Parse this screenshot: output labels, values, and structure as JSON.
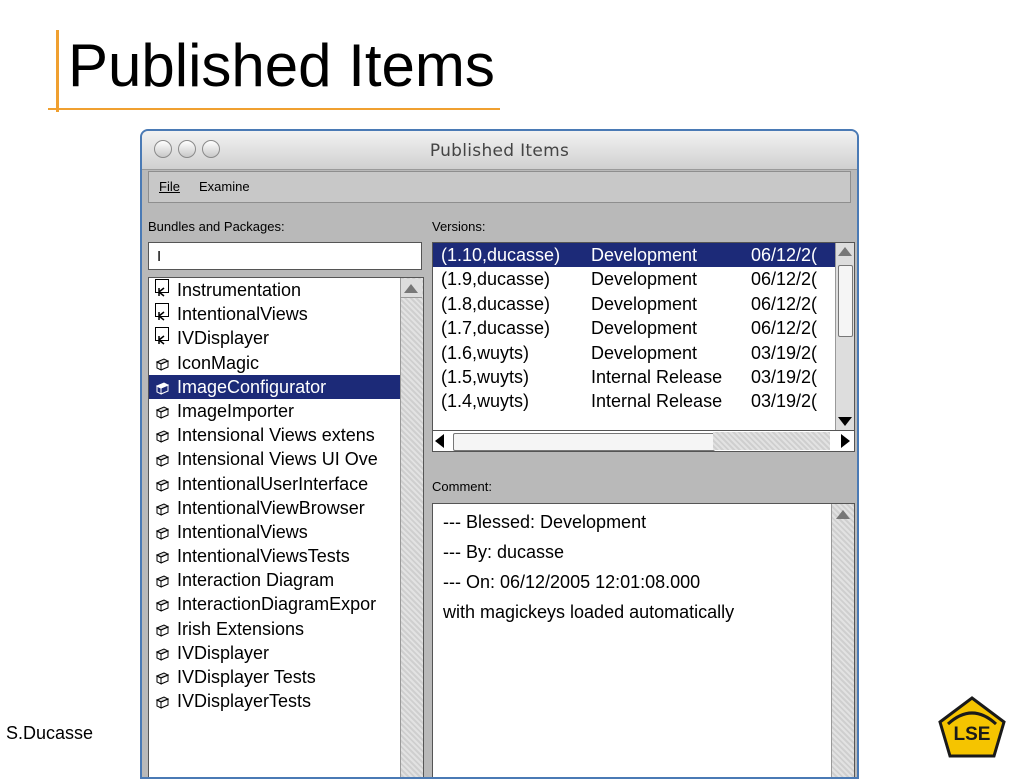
{
  "slide": {
    "title": "Published Items",
    "author": "S.Ducasse",
    "logo_text": "LSE",
    "accent_color": "#f0a030"
  },
  "window": {
    "title": "Published Items",
    "menu": [
      "File",
      "Examine"
    ],
    "bundles_label": "Bundles and Packages:",
    "filter_value": "I",
    "versions_label": "Versions:",
    "comment_label": "Comment:",
    "selection_color": "#1c2a78"
  },
  "packages": [
    {
      "name": "Instrumentation",
      "icon": "bundle-icon",
      "selected": false
    },
    {
      "name": "IntentionalViews",
      "icon": "bundle-icon",
      "selected": false
    },
    {
      "name": "IVDisplayer",
      "icon": "bundle-icon",
      "selected": false
    },
    {
      "name": "IconMagic",
      "icon": "package-icon",
      "selected": false
    },
    {
      "name": "ImageConfigurator",
      "icon": "package-icon",
      "selected": true
    },
    {
      "name": "ImageImporter",
      "icon": "package-icon",
      "selected": false
    },
    {
      "name": "Intensional Views extens",
      "icon": "package-icon",
      "selected": false
    },
    {
      "name": "Intensional Views UI Ove",
      "icon": "package-icon",
      "selected": false
    },
    {
      "name": "IntentionalUserInterface",
      "icon": "package-icon",
      "selected": false
    },
    {
      "name": "IntentionalViewBrowser",
      "icon": "package-icon",
      "selected": false
    },
    {
      "name": "IntentionalViews",
      "icon": "package-icon",
      "selected": false
    },
    {
      "name": "IntentionalViewsTests",
      "icon": "package-icon",
      "selected": false
    },
    {
      "name": "Interaction Diagram",
      "icon": "package-icon",
      "selected": false
    },
    {
      "name": "InteractionDiagramExpor",
      "icon": "package-icon",
      "selected": false
    },
    {
      "name": "Irish Extensions",
      "icon": "package-icon",
      "selected": false
    },
    {
      "name": "IVDisplayer",
      "icon": "package-icon",
      "selected": false
    },
    {
      "name": "IVDisplayer Tests",
      "icon": "package-icon",
      "selected": false
    },
    {
      "name": "IVDisplayerTests",
      "icon": "package-icon",
      "selected": false
    }
  ],
  "versions": [
    {
      "version": "(1.10,ducasse)",
      "status": "Development",
      "date": "06/12/2(",
      "selected": true
    },
    {
      "version": "(1.9,ducasse)",
      "status": "Development",
      "date": "06/12/2(",
      "selected": false
    },
    {
      "version": "(1.8,ducasse)",
      "status": "Development",
      "date": "06/12/2(",
      "selected": false
    },
    {
      "version": "(1.7,ducasse)",
      "status": "Development",
      "date": "06/12/2(",
      "selected": false
    },
    {
      "version": "(1.6,wuyts)",
      "status": "Development",
      "date": "03/19/2(",
      "selected": false
    },
    {
      "version": "(1.5,wuyts)",
      "status": "Internal Release",
      "date": "03/19/2(",
      "selected": false
    },
    {
      "version": "(1.4,wuyts)",
      "status": "Internal Release",
      "date": "03/19/2(",
      "selected": false
    }
  ],
  "comment": [
    "--- Blessed: Development",
    "--- By: ducasse",
    "--- On: 06/12/2005 12:01:08.000",
    "with magickeys loaded automatically"
  ]
}
